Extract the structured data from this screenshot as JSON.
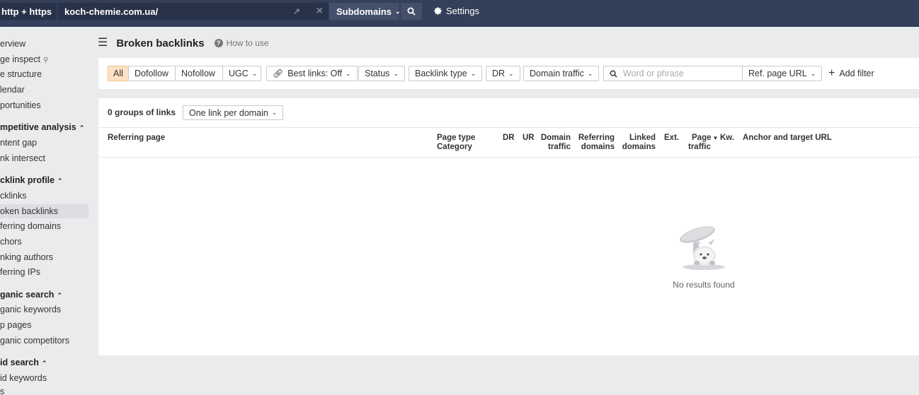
{
  "topbar": {
    "protocol": "http + https",
    "url": "koch-chemie.com.ua/",
    "mode": "Subdomains",
    "settings": "Settings"
  },
  "sidebar": {
    "items": [
      {
        "label": "erview"
      },
      {
        "label": "ge inspect"
      },
      {
        "label": "e structure"
      },
      {
        "label": "lendar"
      },
      {
        "label": "portunities"
      }
    ],
    "competitive": {
      "head": "mpetitive analysis",
      "items": [
        "ntent gap",
        "nk intersect"
      ]
    },
    "backlink": {
      "head": "cklink profile",
      "items": [
        "cklinks",
        "oken backlinks",
        "ferring domains",
        "chors",
        "nking authors",
        "ferring IPs"
      ]
    },
    "organic": {
      "head": "ganic search",
      "items": [
        "ganic keywords",
        "p pages",
        "ganic competitors"
      ]
    },
    "paid": {
      "head": "id search",
      "items": [
        "id keywords",
        "s"
      ]
    }
  },
  "page": {
    "title": "Broken backlinks",
    "how_to": "How to use"
  },
  "filters": {
    "seg_all": "All",
    "seg_dofollow": "Dofollow",
    "seg_nofollow": "Nofollow",
    "seg_ugc": "UGC",
    "best_links": "Best links: Off",
    "status": "Status",
    "backlink_type": "Backlink type",
    "dr": "DR",
    "domain_traffic": "Domain traffic",
    "search_placeholder": "Word or phrase",
    "ref_page_url": "Ref. page URL",
    "add_filter": "Add filter"
  },
  "table": {
    "groups_count": "0 groups of links",
    "per_domain": "One link per domain",
    "columns": {
      "referring_page": "Referring page",
      "page_type": "Page type",
      "category": "Category",
      "dr": "DR",
      "ur": "UR",
      "domain": "Domain",
      "traffic": "traffic",
      "referring": "Referring",
      "domains": "domains",
      "linked": "Linked",
      "linked_domains": "domains",
      "ext": "Ext.",
      "page": "Page",
      "page_traffic": "traffic",
      "kw": "Kw.",
      "anchor_target": "Anchor and target URL"
    },
    "empty_text": "No results found"
  }
}
